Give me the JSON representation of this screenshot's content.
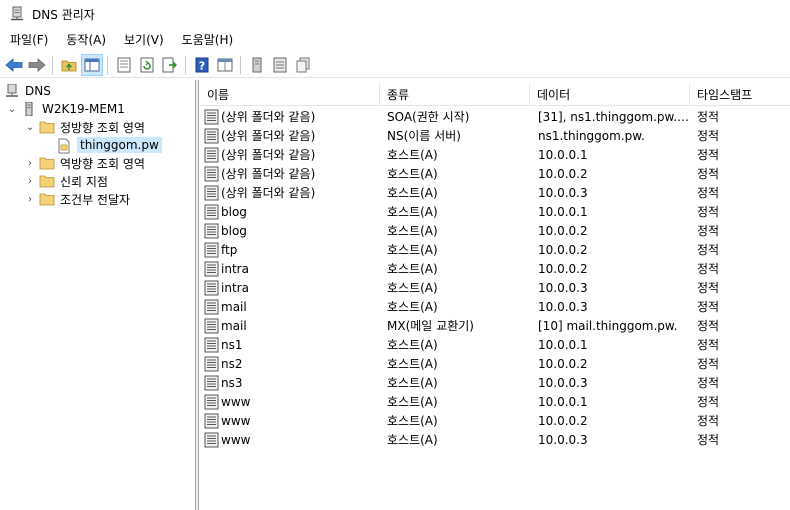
{
  "window": {
    "title": "DNS 관리자"
  },
  "menu": [
    "파일(F)",
    "동작(A)",
    "보기(V)",
    "도움말(H)"
  ],
  "toolbar": [
    "back-icon",
    "forward-icon",
    "up-folder-icon",
    "show-hide-tree-icon",
    "properties-icon",
    "refresh-icon",
    "export-list-icon",
    "help-icon",
    "console-icon",
    "server-icon",
    "list-icon",
    "copy-icon"
  ],
  "tree": {
    "root": "DNS",
    "server": "W2K19-MEM1",
    "forward_zones": "정방향 조회 영역",
    "zone": "thinggom.pw",
    "reverse_zones": "역방향 조회 영역",
    "trust_points": "신뢰 지점",
    "conditional_forwarders": "조건부 전달자"
  },
  "columns": {
    "name": "이름",
    "type": "종류",
    "data": "데이터",
    "timestamp": "타임스탬프"
  },
  "records": [
    {
      "name": "(상위 폴더와 같음)",
      "type": "SOA(권한 시작)",
      "data": "[31], ns1.thinggom.pw., ...",
      "timestamp": "정적"
    },
    {
      "name": "(상위 폴더와 같음)",
      "type": "NS(이름 서버)",
      "data": "ns1.thinggom.pw.",
      "timestamp": "정적"
    },
    {
      "name": "(상위 폴더와 같음)",
      "type": "호스트(A)",
      "data": "10.0.0.1",
      "timestamp": "정적"
    },
    {
      "name": "(상위 폴더와 같음)",
      "type": "호스트(A)",
      "data": "10.0.0.2",
      "timestamp": "정적"
    },
    {
      "name": "(상위 폴더와 같음)",
      "type": "호스트(A)",
      "data": "10.0.0.3",
      "timestamp": "정적"
    },
    {
      "name": "blog",
      "type": "호스트(A)",
      "data": "10.0.0.1",
      "timestamp": "정적"
    },
    {
      "name": "blog",
      "type": "호스트(A)",
      "data": "10.0.0.2",
      "timestamp": "정적"
    },
    {
      "name": "ftp",
      "type": "호스트(A)",
      "data": "10.0.0.2",
      "timestamp": "정적"
    },
    {
      "name": "intra",
      "type": "호스트(A)",
      "data": "10.0.0.2",
      "timestamp": "정적"
    },
    {
      "name": "intra",
      "type": "호스트(A)",
      "data": "10.0.0.3",
      "timestamp": "정적"
    },
    {
      "name": "mail",
      "type": "호스트(A)",
      "data": "10.0.0.3",
      "timestamp": "정적"
    },
    {
      "name": "mail",
      "type": "MX(메일 교환기)",
      "data": "[10]  mail.thinggom.pw.",
      "timestamp": "정적"
    },
    {
      "name": "ns1",
      "type": "호스트(A)",
      "data": "10.0.0.1",
      "timestamp": "정적"
    },
    {
      "name": "ns2",
      "type": "호스트(A)",
      "data": "10.0.0.2",
      "timestamp": "정적"
    },
    {
      "name": "ns3",
      "type": "호스트(A)",
      "data": "10.0.0.3",
      "timestamp": "정적"
    },
    {
      "name": "www",
      "type": "호스트(A)",
      "data": "10.0.0.1",
      "timestamp": "정적"
    },
    {
      "name": "www",
      "type": "호스트(A)",
      "data": "10.0.0.2",
      "timestamp": "정적"
    },
    {
      "name": "www",
      "type": "호스트(A)",
      "data": "10.0.0.3",
      "timestamp": "정적"
    }
  ]
}
